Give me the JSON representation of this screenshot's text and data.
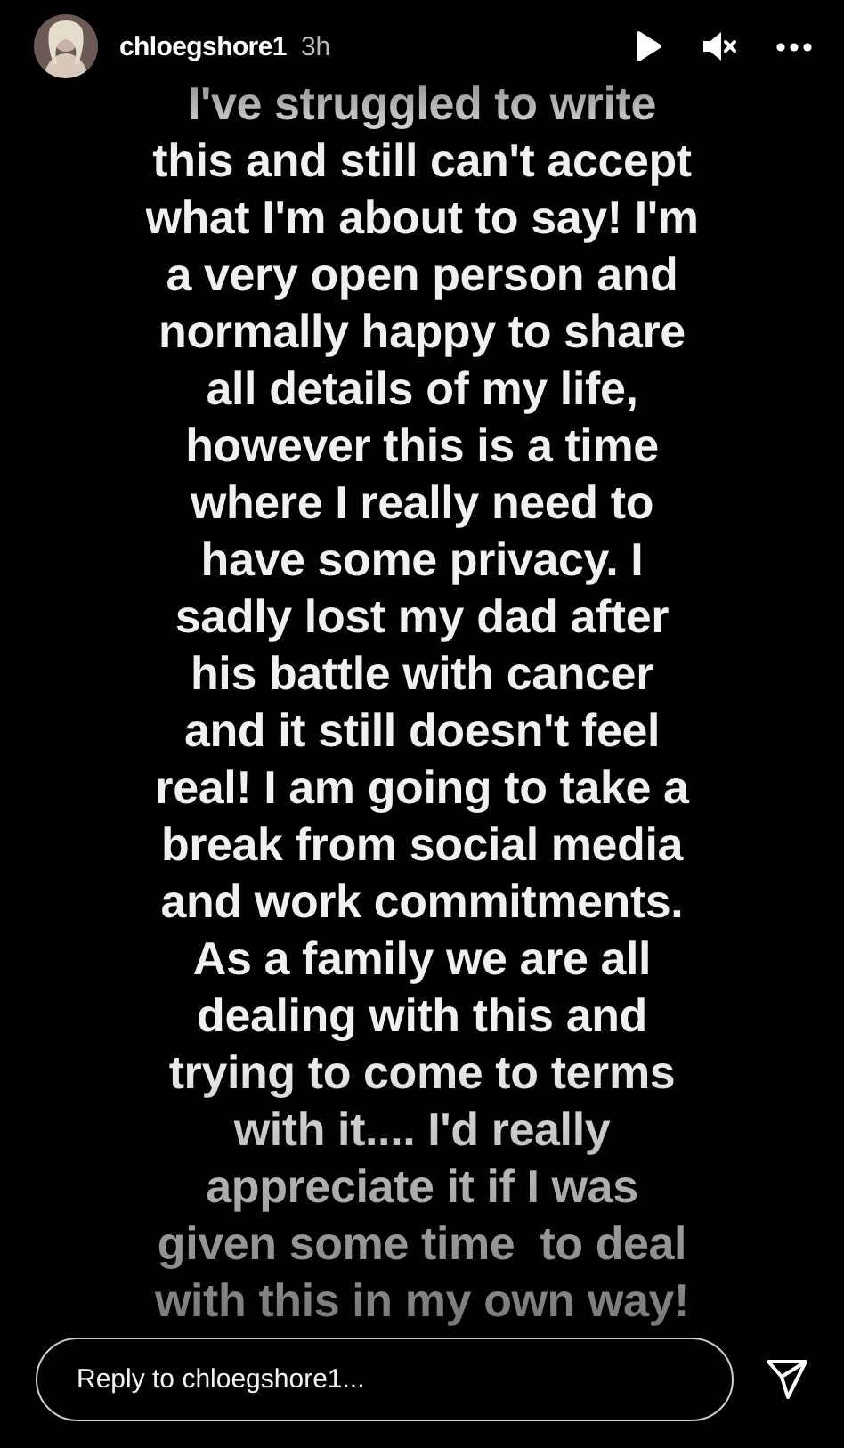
{
  "header": {
    "username": "chloegshore1",
    "time": "3h",
    "muted": true
  },
  "story": {
    "lines": [
      "I've struggled to write",
      "this and still can't accept",
      "what I'm about to say! I'm",
      "a very open person and",
      "normally happy to share",
      "all details of my life,",
      "however this is a time",
      "where I really need to",
      "have some privacy. I",
      "sadly lost my dad after",
      "his battle with cancer",
      "and it still doesn't feel",
      "real! I am going to take a",
      "break from social media",
      "and work commitments.",
      "As a family we are all",
      "dealing with this and",
      "trying to come to terms",
      "with it.... I'd really",
      "appreciate it if I was",
      "given some time  to deal",
      "with this in my own way!"
    ]
  },
  "reply": {
    "placeholder": "Reply to chloegshore1..."
  }
}
